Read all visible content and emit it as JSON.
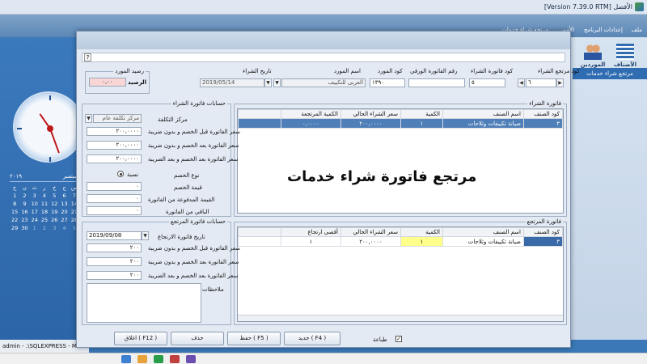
{
  "app": {
    "title": "[Version 7.39.0 RTM] الأفضل",
    "menu": [
      "ملف",
      "إعدادات البرنامج",
      "الأمور",
      "مرتجع شراء خدمات"
    ],
    "side_buttons": [
      {
        "label": "الأصناف"
      },
      {
        "label": "الموردين"
      }
    ],
    "side_tab": "مرتجع شراء خدمات",
    "status_user": "admin - .\\SQLEXPRESS - M",
    "calendar": {
      "month": "سبتمبر",
      "year": "٢٠١٩",
      "weekdays": [
        "ح",
        "ن",
        "ث",
        "ر",
        "خ",
        "ج",
        "س"
      ],
      "days": [
        "1",
        "2",
        "3",
        "4",
        "5",
        "6",
        "7",
        "8",
        "9",
        "10",
        "11",
        "12",
        "13",
        "14",
        "15",
        "16",
        "17",
        "18",
        "19",
        "20",
        "21",
        "22",
        "23",
        "24",
        "25",
        "26",
        "27",
        "28",
        "29",
        "30",
        "1",
        "2",
        "3",
        "4",
        "5"
      ]
    }
  },
  "dialog": {
    "help": "?",
    "overlay_title": "مرتجع فاتورة شراء خدمات",
    "header": {
      "return_code_label": "كود مرتجع الشراء",
      "return_code_value": "٦",
      "invoice_code_label": "كود فاتورة الشراء",
      "invoice_code_value": "٥",
      "paper_invoice_label": "رقم الفاتورة الورقي",
      "paper_invoice_value": "",
      "supplier_code_label": "كود المورد",
      "supplier_code_value": "١٣٩٠",
      "supplier_name_label": "اسم المورد",
      "supplier_name_value": "العربى للتكييف",
      "purchase_date_label": "تاريخ الشراء",
      "purchase_date_value": "2019/05/14",
      "supplier_balance_label": "رصيد المورد",
      "balance_label": "الرصيد",
      "balance_value": "٠,٠٠"
    },
    "purchase_invoice": {
      "title": "فاتورة الشراء",
      "columns": [
        "كود الصنف",
        "اسم الصنف",
        "الكمية",
        "سعر الشراء الحالي",
        "الكمية المرتجعة"
      ],
      "rows": [
        [
          "٣",
          "صيانة تكييفات وثلاجات",
          "١",
          "٢٠٠,٠٠٠٠",
          "٠,٠٠٠٠"
        ]
      ]
    },
    "purchase_calc": {
      "title": "حسابات فاتورة الشراء",
      "cost_center_label": "مركز التكلفة",
      "cost_center_value": "مركز تكلفة عام",
      "before_disc_label": "سعر الفاتورة قبل الخصم و بدون ضريبة",
      "before_disc_value": "٢٠٠,٠٠٠٠",
      "after_disc_no_tax_label": "سعر الفاتورة بعد الخصم و بدون ضريبة",
      "after_disc_no_tax_value": "٢٠٠,٠٠٠٠",
      "after_disc_tax_label": "سعر الفاتورة بعد الخصم و بعد الضريبة",
      "after_disc_tax_value": "٢٠٠,٠٠٠٠",
      "discount_type_label": "نوع الخصم",
      "discount_type_option": "نسبة",
      "discount_value_label": "قيمة الخصم",
      "discount_value": "٠",
      "paid_label": "القيمة المدفوعة من الفاتورة",
      "paid_value": "٠",
      "remaining_label": "الباقي من الفاتورة",
      "remaining_value": "٠"
    },
    "return_invoice": {
      "title": "فاتورة المرتجع",
      "columns": [
        "كود الصنف",
        "اسم الصنف",
        "الكمية",
        "سعر الشراء الحالي",
        "أقصى ارتجاع"
      ],
      "rows": [
        [
          "٣",
          "صيانة تكييفات وثلاجات",
          "١",
          "٢٠٠,٠٠٠٠",
          "١"
        ]
      ]
    },
    "return_calc": {
      "title": "حسابات فاتورة المرتجع",
      "return_date_label": "تاريخ فاتورة الارتجاع",
      "return_date_value": "2019/09/08",
      "before_disc_label": "سعر الفاتورة قبل الخصم و بدون ضريبة",
      "before_disc_value": "٢٠٠",
      "after_disc_no_tax_label": "سعر الفاتورة بعد الخصم و بدون ضريبة",
      "after_disc_no_tax_value": "٢٠٠",
      "after_disc_tax_label": "سعر الفاتورة بعد الخصم و بعد الضريبة",
      "after_disc_tax_value": "٢٠٠",
      "notes_label": "ملاحظات",
      "notes_value": ""
    },
    "footer": {
      "print_label": "طباعة",
      "new_label": "جديد ( F4 )",
      "save_label": "حفظ ( F5 )",
      "delete_label": "حذف",
      "close_label": "اغلاق ( F12 )"
    }
  }
}
